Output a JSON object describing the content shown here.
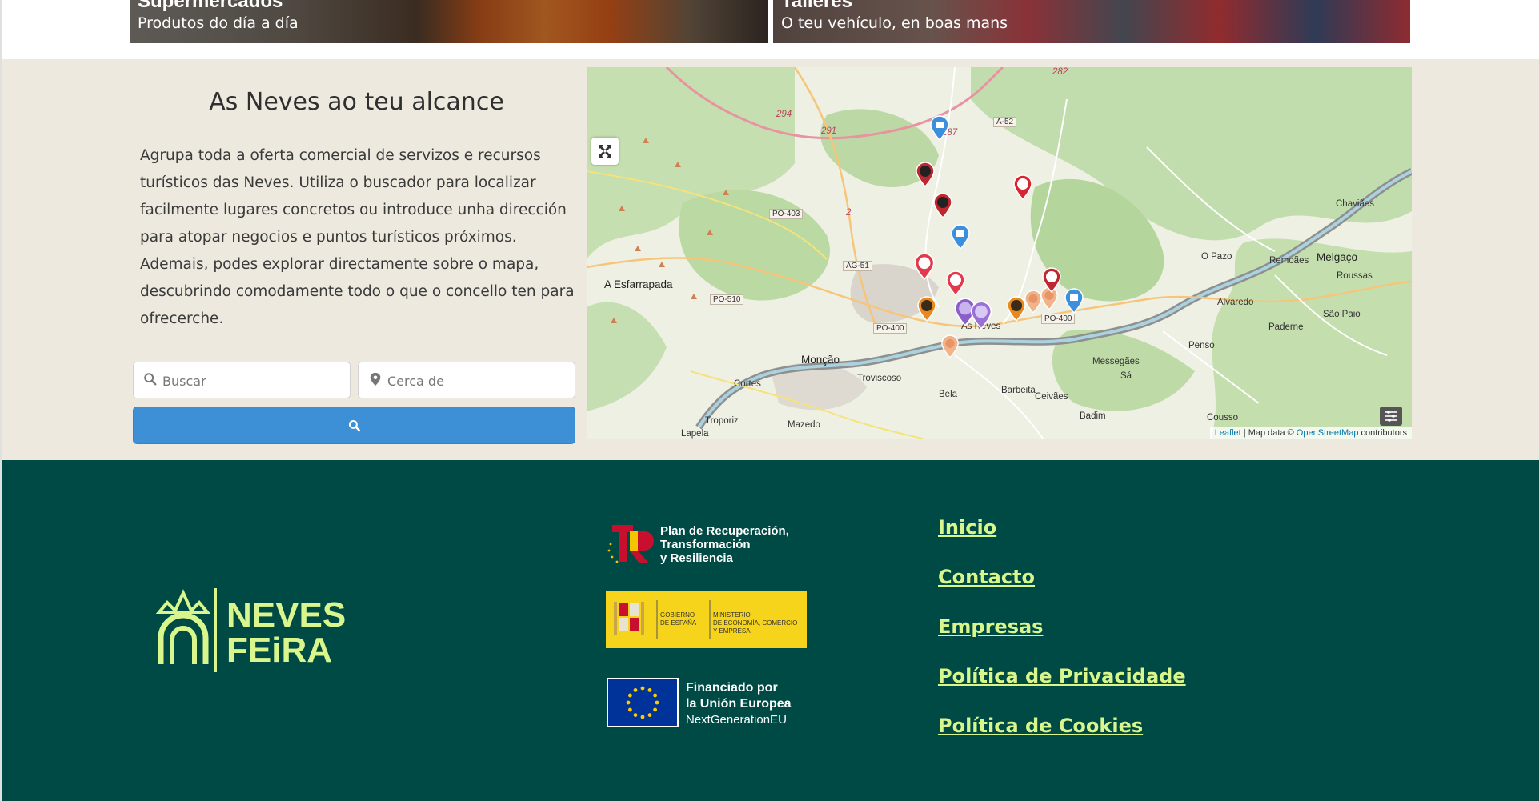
{
  "cards": [
    {
      "title": "Supermercados",
      "subtitle": "Produtos do día a día"
    },
    {
      "title": "Talleres",
      "subtitle": "O teu vehículo, en boas mans"
    }
  ],
  "intro": {
    "title": "As Neves ao teu alcance",
    "text": "Agrupa toda a oferta comercial de servizos e recursos turísticos das Neves. Utiliza o buscador para localizar facilmente lugares concretos ou introduce unha dirección para atopar negocios e puntos turísticos próximos. Ademais, podes explorar directamente sobre o mapa, descubrindo comodamente todo o que o concello ten para ofrecerche."
  },
  "search": {
    "query_placeholder": "Buscar",
    "near_placeholder": "Cerca de",
    "button_icon": "search-icon"
  },
  "map": {
    "places": [
      "A Esfarrapada",
      "Monção",
      "Cortes",
      "Troviscoso",
      "Troporiz",
      "Mazedo",
      "Lapela",
      "Bela",
      "Barbeita",
      "Ceivães",
      "Messegães",
      "Sá",
      "Badim",
      "Cousso",
      "Penso",
      "Alvaredo",
      "Paderne",
      "São Paio",
      "Remoães",
      "Melgaço",
      "Roussas",
      "Chaviães",
      "O Pazo",
      "As Neves"
    ],
    "roads": [
      "A-52",
      "PO-403",
      "AG-51",
      "PO-510",
      "PO-400",
      "PO-400",
      "287",
      "291",
      "294",
      "282",
      "2"
    ],
    "attribution_leaflet": "Leaflet",
    "attribution_mid": "| Map data ©",
    "attribution_osm": "OpenStreetMap",
    "attribution_end": "contributors",
    "fullscreen_icon": "expand-icon",
    "layers_icon": "layers-icon"
  },
  "footer": {
    "logo_line1": "NEVES",
    "logo_line2": "FEiRA",
    "funding": {
      "plan_line1": "Plan de Recuperación,",
      "plan_line2": "Transformación",
      "plan_line3": "y Resiliencia",
      "gov_left_1": "GOBIERNO",
      "gov_left_2": "DE ESPAÑA",
      "gov_right_1": "MINISTERIO",
      "gov_right_2": "DE ECONOMÍA, COMERCIO",
      "gov_right_3": "Y EMPRESA",
      "eu_line1": "Financiado por",
      "eu_line2": "la Unión Europea",
      "eu_line3": "NextGenerationEU"
    },
    "nav": [
      "Inicio",
      "Contacto",
      "Empresas",
      "Política de Privacidade",
      "Política de Cookies"
    ]
  },
  "colors": {
    "footer_bg": "#004a45",
    "accent_green": "#d9f68c",
    "search_button": "#3d8fd6",
    "section_bg": "#ede9df"
  }
}
